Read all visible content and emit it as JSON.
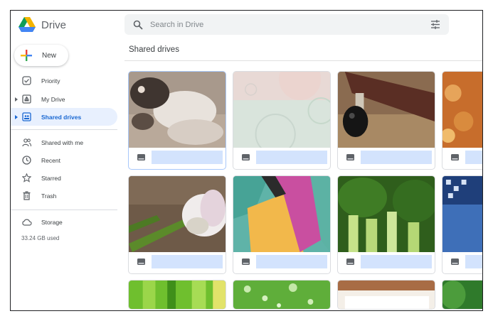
{
  "app": {
    "name": "Drive",
    "brand_colors": {
      "green": "#0F9D58",
      "blue": "#4285F4",
      "yellow": "#F4B400",
      "red": "#DB4437"
    }
  },
  "search": {
    "placeholder": "Search in Drive",
    "icon": "search-icon",
    "options_icon": "tune-icon"
  },
  "new_button": {
    "label": "New",
    "icon": "plus-icon"
  },
  "sidebar": {
    "items": [
      {
        "label": "Priority",
        "icon": "priority-icon",
        "active": false,
        "expandable": false
      },
      {
        "label": "My Drive",
        "icon": "my-drive-icon",
        "active": false,
        "expandable": true
      },
      {
        "label": "Shared drives",
        "icon": "shared-drives-icon",
        "active": true,
        "expandable": true
      },
      {
        "label": "Shared with me",
        "icon": "people-icon",
        "active": false,
        "expandable": false
      },
      {
        "label": "Recent",
        "icon": "clock-icon",
        "active": false,
        "expandable": false
      },
      {
        "label": "Starred",
        "icon": "star-icon",
        "active": false,
        "expandable": false
      },
      {
        "label": "Trash",
        "icon": "trash-icon",
        "active": false,
        "expandable": false
      },
      {
        "label": "Storage",
        "icon": "cloud-icon",
        "active": false,
        "expandable": false
      }
    ],
    "storage_used": "33.24 GB used",
    "active_color": "#e8f0fe"
  },
  "main": {
    "title": "Shared drives",
    "drives": [
      {
        "thumbnail": "animal-closeup",
        "selected": true
      },
      {
        "thumbnail": "soap-bubbles",
        "selected": false
      },
      {
        "thumbnail": "wooden-lever",
        "selected": false
      },
      {
        "thumbnail": "baked-food",
        "selected": false
      },
      {
        "thumbnail": "white-flower-bud",
        "selected": false
      },
      {
        "thumbnail": "colored-papers",
        "selected": false
      },
      {
        "thumbnail": "green-leafy-vegetable",
        "selected": false
      },
      {
        "thumbnail": "blue-keyboard",
        "selected": false
      },
      {
        "thumbnail": "green-stalks",
        "selected": false
      },
      {
        "thumbnail": "water-drops-on-leaf",
        "selected": false
      },
      {
        "thumbnail": "brown-paper",
        "selected": false
      },
      {
        "thumbnail": "green-leaf",
        "selected": false
      }
    ]
  }
}
